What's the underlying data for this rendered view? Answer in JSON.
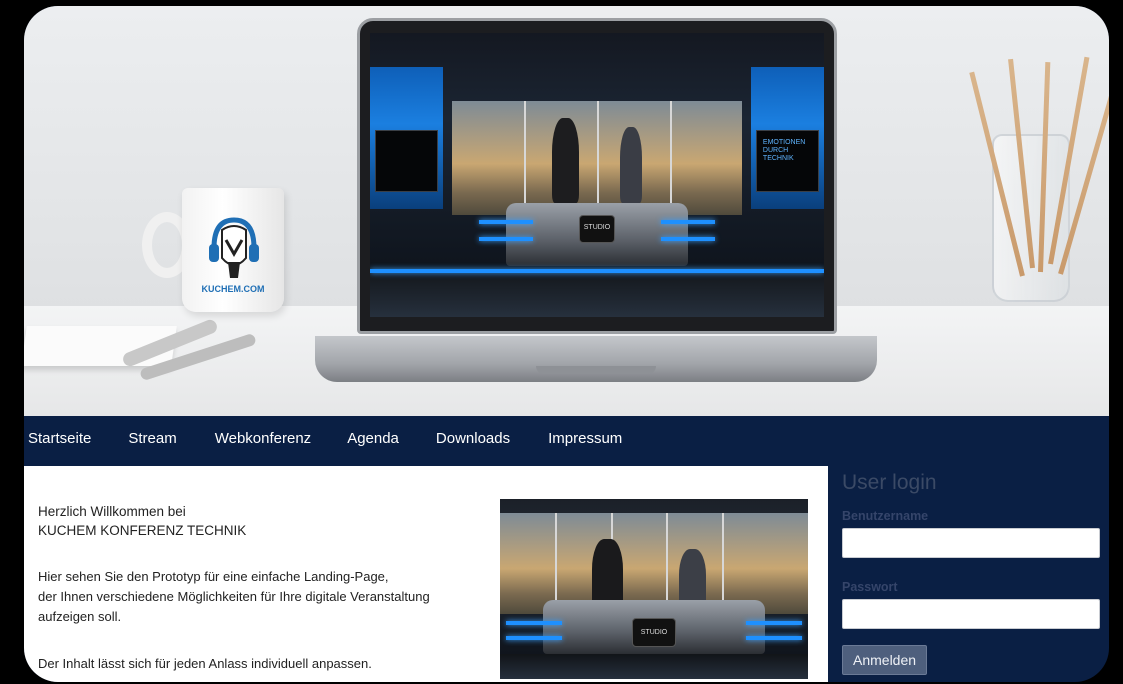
{
  "hero": {
    "mug_text": "KUCHEM.COM",
    "screen_monitor_text": "EMOTIONEN DURCH TECHNIK",
    "studio_logo_text": "STUDIO"
  },
  "nav": {
    "items": [
      {
        "label": "Startseite"
      },
      {
        "label": "Stream"
      },
      {
        "label": "Webkonferenz"
      },
      {
        "label": "Agenda"
      },
      {
        "label": "Downloads"
      },
      {
        "label": "Impressum"
      }
    ]
  },
  "content": {
    "welcome_line1": "Herzlich Willkommen bei",
    "welcome_line2": "KUCHEM KONFERENZ TECHNIK",
    "intro_line1": "Hier sehen Sie den Prototyp für eine einfache Landing-Page,",
    "intro_line2": "der Ihnen verschiedene Möglichkeiten für Ihre digitale Veranstaltung",
    "intro_line3": "aufzeigen soll.",
    "intro_line4": "Der Inhalt lässt sich für jeden Anlass individuell anpassen."
  },
  "login": {
    "title": "User login",
    "username_label": "Benutzername",
    "username_value": "",
    "password_label": "Passwort",
    "password_value": "",
    "submit_label": "Anmelden"
  },
  "colors": {
    "nav_bg": "#0a1f44",
    "accent_blue": "#1e90ff",
    "button_bg": "#4e5f7d"
  }
}
